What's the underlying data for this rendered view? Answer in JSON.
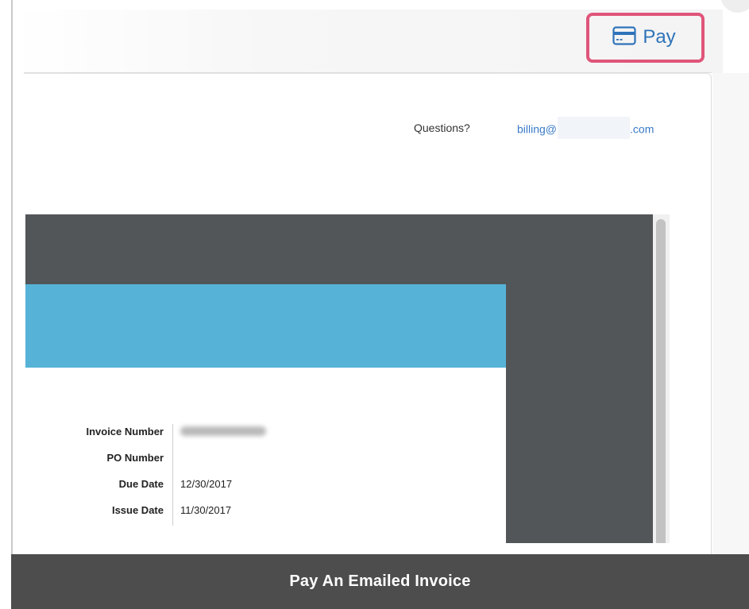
{
  "header": {
    "pay_button": {
      "label": "Pay",
      "icon": "credit-card-icon",
      "color": "#2e73b9"
    },
    "highlight_color": "#e0557a"
  },
  "contact": {
    "questions_label": "Questions?",
    "email_prefix": "billing@",
    "email_suffix": ".com"
  },
  "invoice": {
    "banner_color": "#56b3d7",
    "rows": [
      {
        "label": "Invoice Number",
        "value": ""
      },
      {
        "label": "PO Number",
        "value": ""
      },
      {
        "label": "Due Date",
        "value": "12/30/2017"
      },
      {
        "label": "Issue Date",
        "value": "11/30/2017"
      }
    ]
  },
  "footer": {
    "title": "Pay An Emailed Invoice"
  }
}
